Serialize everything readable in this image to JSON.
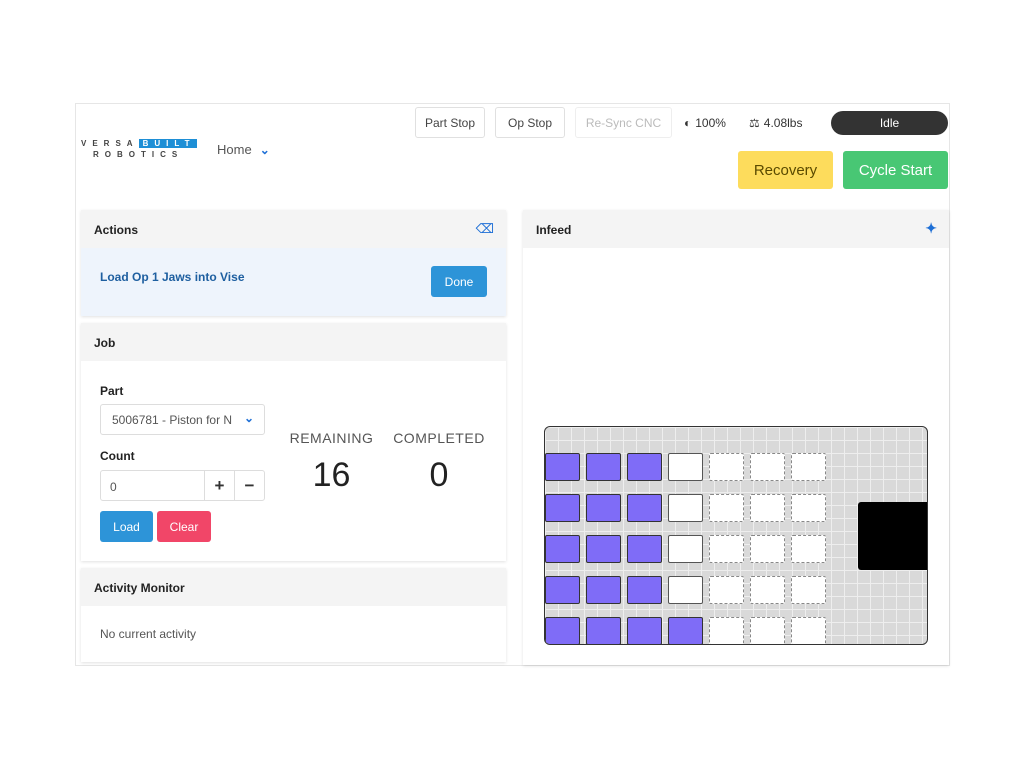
{
  "header": {
    "logo_top_a": "VERSA",
    "logo_top_b": "BUILT",
    "logo_bottom": "ROBOTICS",
    "nav": "Home",
    "part_stop": "Part Stop",
    "op_stop": "Op Stop",
    "resync": "Re-Sync CNC",
    "speed": "100%",
    "weight": "4.08lbs",
    "status": "Idle",
    "recovery": "Recovery",
    "cycle_start": "Cycle Start"
  },
  "actions": {
    "title": "Actions",
    "message": "Load Op 1 Jaws into Vise",
    "done": "Done"
  },
  "job": {
    "title": "Job",
    "part_label": "Part",
    "part_value": "5006781 - Piston for N",
    "count_label": "Count",
    "count_value": "0",
    "plus": "+",
    "minus": "−",
    "load": "Load",
    "clear": "Clear",
    "remaining_label": "REMAINING",
    "remaining": "16",
    "completed_label": "COMPLETED",
    "completed": "0"
  },
  "activity": {
    "title": "Activity Monitor",
    "message": "No current activity"
  },
  "infeed": {
    "title": "Infeed",
    "grid": [
      [
        "loaded",
        "loaded",
        "loaded",
        "next",
        "empty",
        "empty",
        "empty"
      ],
      [
        "loaded",
        "loaded",
        "loaded",
        "next",
        "empty",
        "empty",
        "empty"
      ],
      [
        "loaded",
        "loaded",
        "loaded",
        "next",
        "empty",
        "empty",
        "empty"
      ],
      [
        "loaded",
        "loaded",
        "loaded",
        "next",
        "empty",
        "empty",
        "empty"
      ],
      [
        "loaded",
        "loaded",
        "loaded",
        "loaded",
        "empty",
        "empty",
        "empty"
      ]
    ]
  },
  "colors": {
    "accent": "#1e8fd6",
    "loaded": "#7f6cf7",
    "recovery": "#fddc5c",
    "cycle": "#48c774",
    "clear": "#f14668"
  }
}
